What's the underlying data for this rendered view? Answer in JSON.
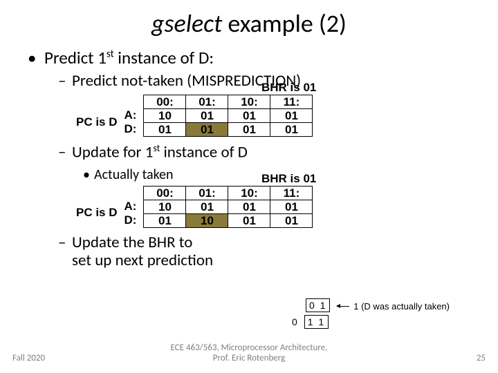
{
  "title": {
    "ital": "gselect",
    "rest": " example (2)"
  },
  "bullets": {
    "l1": "Predict 1st instance of D:",
    "l2a": "Predict not-taken (MISPREDICTION)",
    "l2b": "Update for 1st instance of D",
    "l3": "Actually taken",
    "l2c_line1": "Update the BHR to",
    "l2c_line2": "set up next prediction"
  },
  "table1": {
    "pc": "PC is D",
    "rowA": "A:",
    "rowD": "D:",
    "bhr_caption": "BHR is 01",
    "headers": [
      "00:",
      "01:",
      "10:",
      "11:"
    ],
    "rows": {
      "A": [
        "10",
        "01",
        "01",
        "01"
      ],
      "D": [
        "01",
        "01",
        "01",
        "01"
      ]
    },
    "highlight": {
      "row": "D",
      "colIndex": 1
    }
  },
  "table2": {
    "pc": "PC is D",
    "rowA": "A:",
    "rowD": "D:",
    "bhr_caption": "BHR is 01",
    "headers": [
      "00:",
      "01:",
      "10:",
      "11:"
    ],
    "rows": {
      "A": [
        "10",
        "01",
        "01",
        "01"
      ],
      "D": [
        "01",
        "10",
        "01",
        "01"
      ]
    },
    "highlight": {
      "row": "D",
      "colIndex": 1
    }
  },
  "bhr_update": {
    "old": "0 1",
    "shift_in": "0",
    "new": "1 1",
    "note": "1 (D was actually taken)"
  },
  "footer": {
    "left": "Fall 2020",
    "center_line1": "ECE 463/563, Microprocessor Architecture,",
    "center_line2": "Prof. Eric Rotenberg",
    "right": "25"
  },
  "chart_data": {
    "type": "table",
    "description": "Two PHT tables (rows A,D × BHR cols 00,01,10,11) before and after update of D at BHR=01",
    "before": {
      "columns": [
        "00",
        "01",
        "10",
        "11"
      ],
      "rows": {
        "A": [
          "10",
          "01",
          "01",
          "01"
        ],
        "D": [
          "01",
          "01",
          "01",
          "01"
        ]
      },
      "bhr": "01",
      "highlighted": "D,01"
    },
    "after": {
      "columns": [
        "00",
        "01",
        "10",
        "11"
      ],
      "rows": {
        "A": [
          "10",
          "01",
          "01",
          "01"
        ],
        "D": [
          "01",
          "10",
          "01",
          "01"
        ]
      },
      "bhr": "01",
      "highlighted": "D,01"
    },
    "bhr_shift": {
      "from": "01",
      "bit_in": "1",
      "to": "11"
    }
  }
}
